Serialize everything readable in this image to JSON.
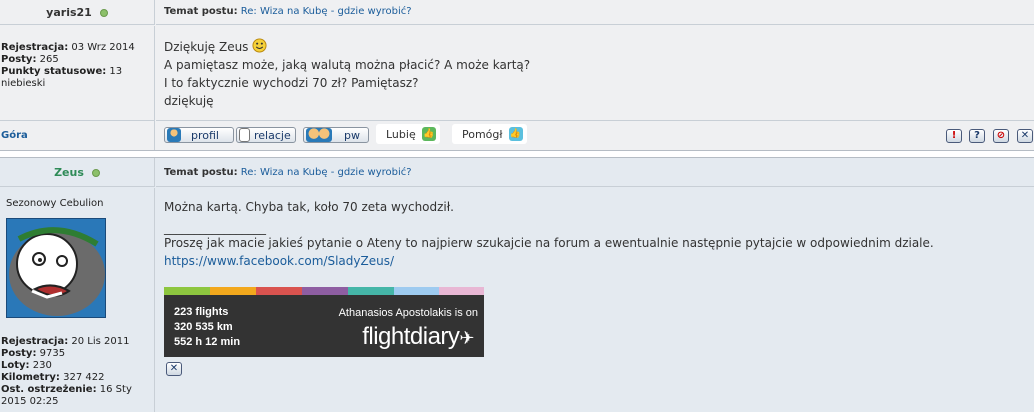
{
  "post1": {
    "username": "yaris21",
    "topic_label": "Temat postu:",
    "topic_title": "Re: Wiza na Kubę - gdzie wyrobić?",
    "stats": [
      {
        "label": "Rejestracja:",
        "value": "03 Wrz 2014"
      },
      {
        "label": "Posty:",
        "value": "265"
      },
      {
        "label": "Punkty statusowe:",
        "value": "13"
      }
    ],
    "stats_extra": "niebieski",
    "lines": [
      "Dziękuję Zeus",
      "A pamiętasz może, jaką walutą można płacić? A może kartą?",
      "I to faktycznie wychodzi 70 zł? Pamiętasz?",
      "dziękuję"
    ],
    "gora": "Góra",
    "buttons": {
      "profile": "profil",
      "relations": "relacje",
      "pm": "pw"
    },
    "like_label": "Lubię",
    "helped_label": "Pomógł",
    "mini_icons": {
      "report": "!",
      "quote": "?",
      "ban": "⊘",
      "delete": "✕"
    }
  },
  "post2": {
    "username": "Zeus",
    "topic_label": "Temat postu:",
    "topic_title": "Re: Wiza na Kubę - gdzie wyrobić?",
    "rank": "Sezonowy Cebulion",
    "stats": [
      {
        "label": "Rejestracja:",
        "value": "20 Lis 2011"
      },
      {
        "label": "Posty:",
        "value": "9735"
      },
      {
        "label": "Loty:",
        "value": "230"
      },
      {
        "label": "Kilometry:",
        "value": "327 422"
      },
      {
        "label": "Ost. ostrzeżenie:",
        "value": "16 Sty"
      }
    ],
    "stats_extra": "2015 02:25",
    "line1": "Można kartą. Chyba tak, koło 70 zeta wychodził.",
    "signature_rule": "_________________",
    "signature_text": "Proszę jak macie jakieś pytanie o Ateny to najpierw szukajcie na forum a ewentualnie następnie pytajcie w odpowiednim dziale.",
    "signature_link": "https://www.facebook.com/SladyZeus/",
    "flightdiary": {
      "flights": "223 flights",
      "distance": "320 535 km",
      "time": "552 h 12 min",
      "owner_line": "Athanasios Apostolakis is on",
      "logo": "flightdiary"
    },
    "close_icon": "✕"
  },
  "colors": {
    "link": "#1a5c9a",
    "online": "#8cc06a",
    "post1_bg": "#eff0f2",
    "post2_bg": "#e4eaf0",
    "zeus_name": "#2e8b57",
    "stripe": [
      "#8dc63f",
      "#f2a81d",
      "#d9534f",
      "#8e5ea2",
      "#45b6a8",
      "#9ecbf0",
      "#e8b7d4"
    ]
  }
}
